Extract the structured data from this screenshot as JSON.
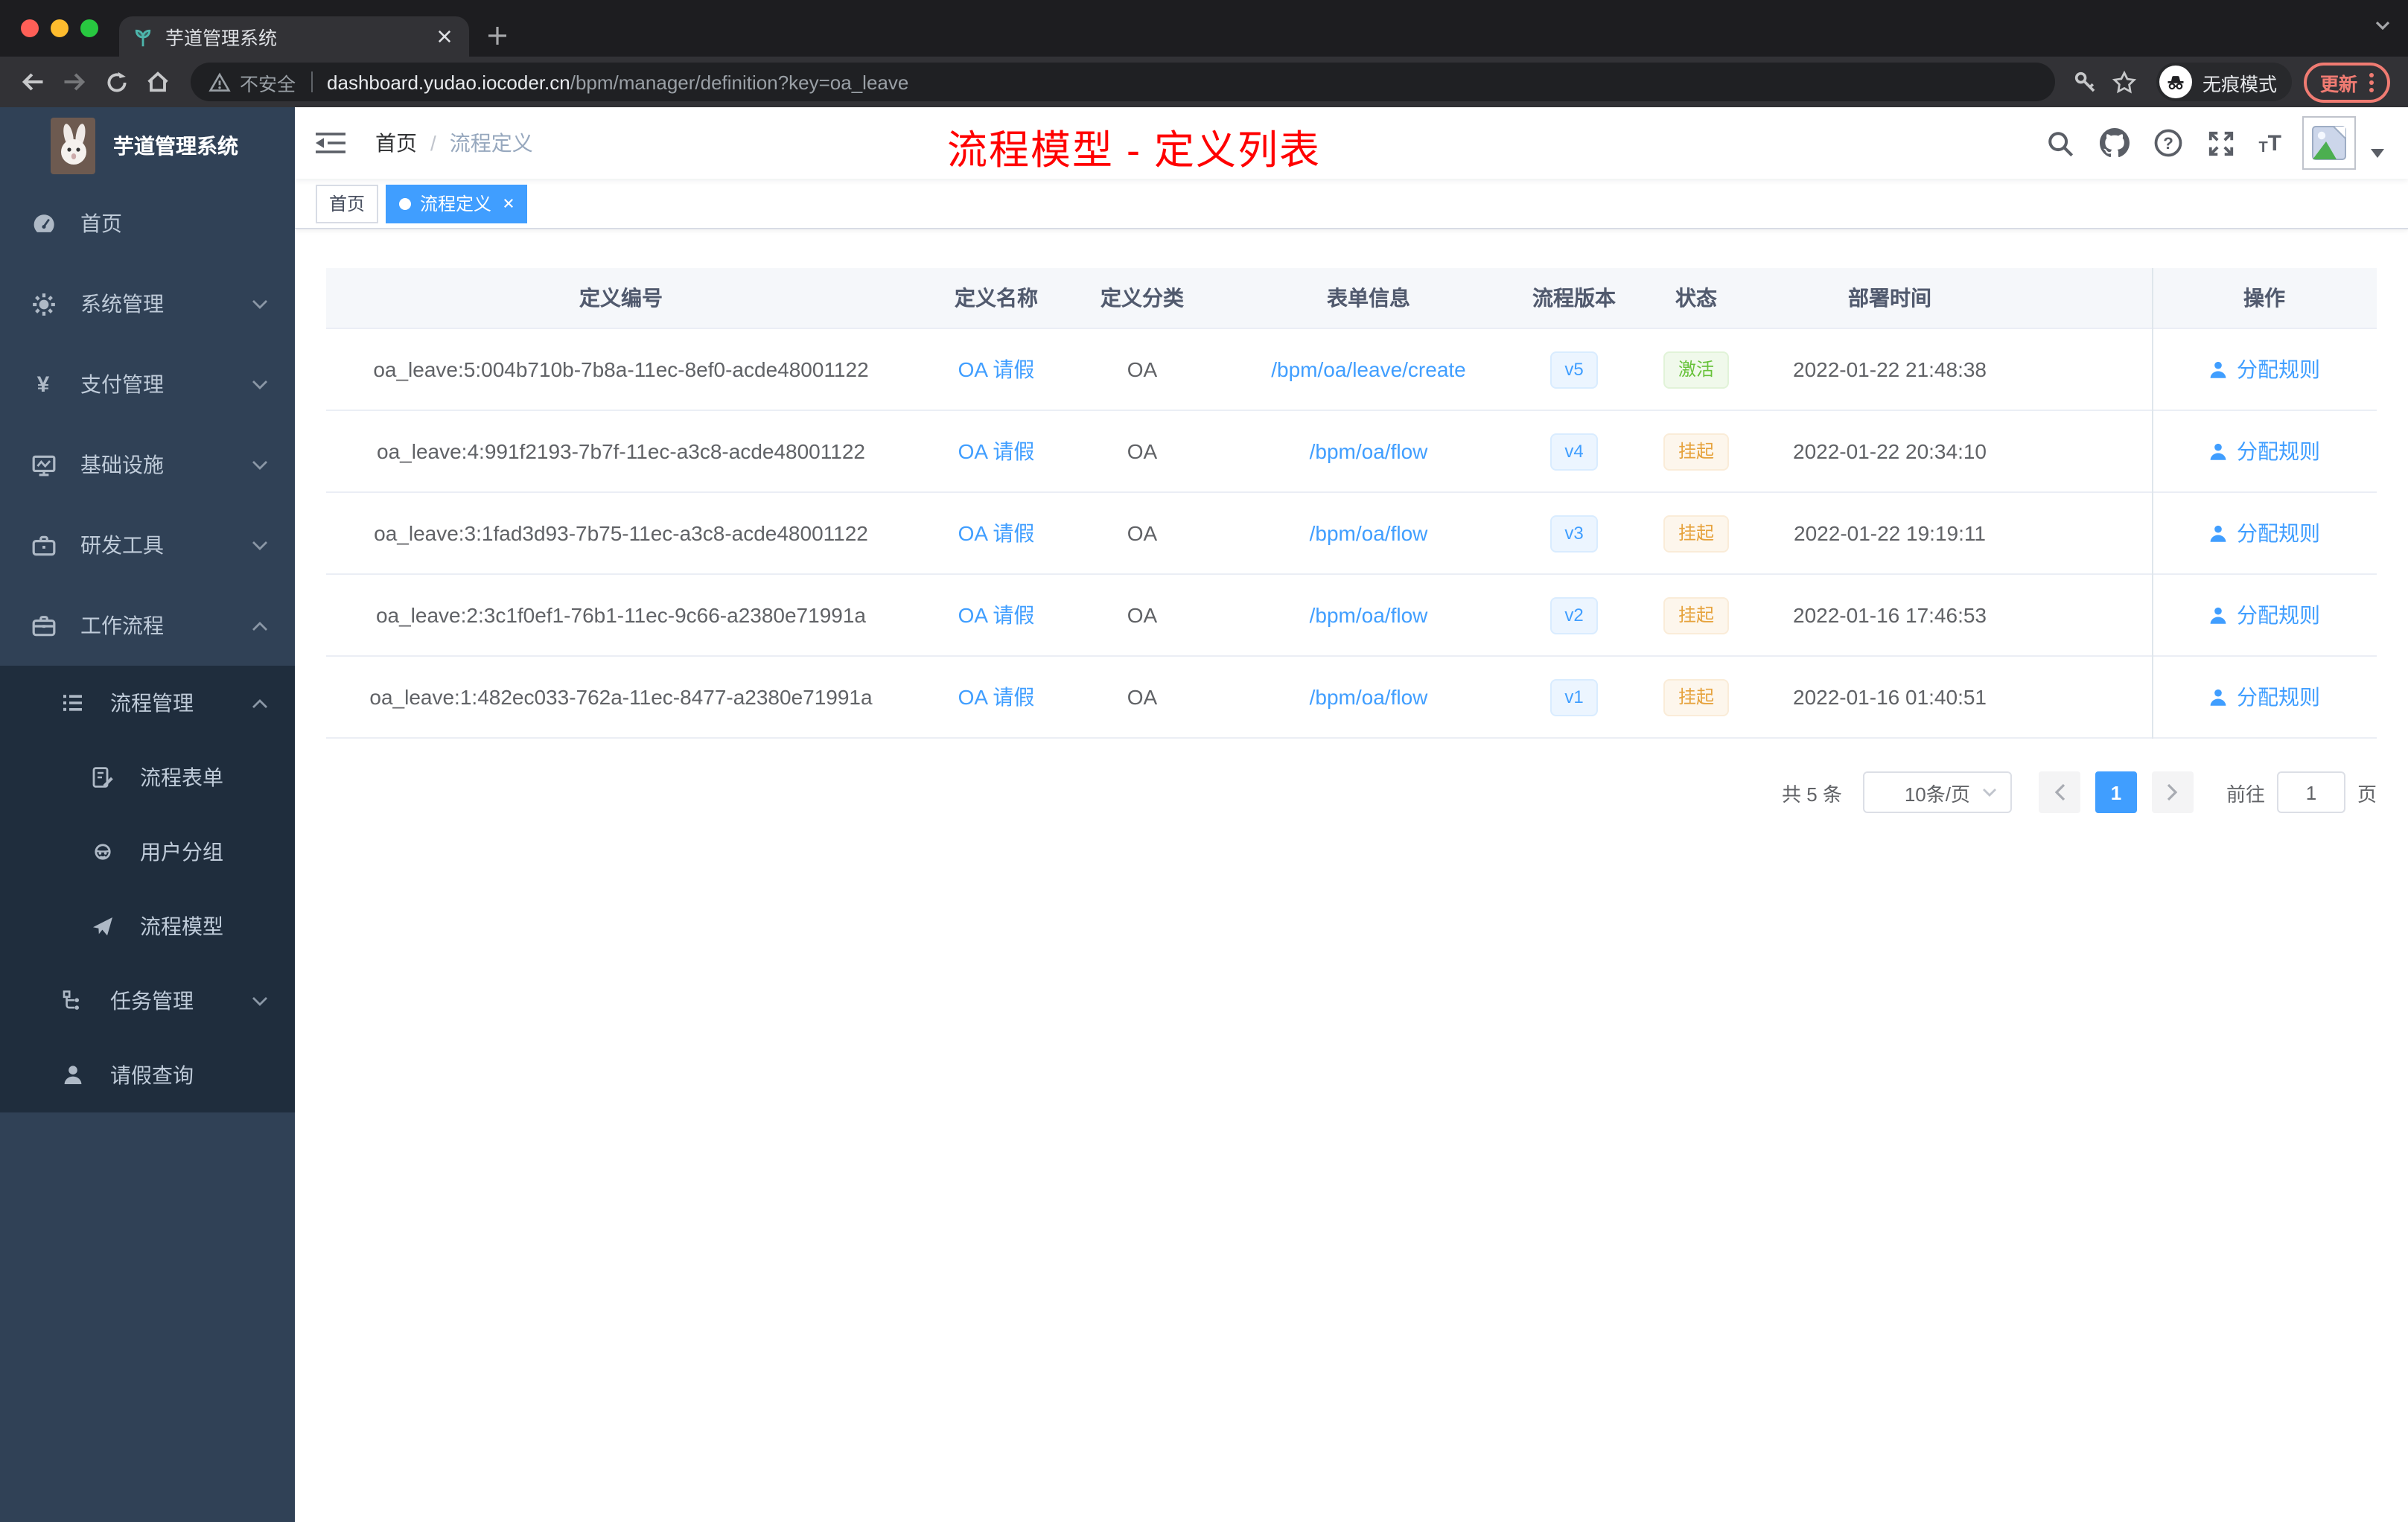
{
  "browser": {
    "tab_title": "芋道管理系统",
    "security_label": "不安全",
    "url_domain": "dashboard.yudao.iocoder.cn",
    "url_path": "/bpm/manager/definition?key=oa_leave",
    "incognito_label": "无痕模式",
    "update_label": "更新"
  },
  "sidebar": {
    "logo_title": "芋道管理系统",
    "items": [
      {
        "label": "首页"
      },
      {
        "label": "系统管理"
      },
      {
        "label": "支付管理",
        "icon_char": "¥"
      },
      {
        "label": "基础设施"
      },
      {
        "label": "研发工具"
      },
      {
        "label": "工作流程"
      }
    ],
    "workflow_submenu": [
      {
        "label": "流程管理"
      },
      {
        "label": "流程表单"
      },
      {
        "label": "用户分组"
      },
      {
        "label": "流程模型"
      },
      {
        "label": "任务管理"
      },
      {
        "label": "请假查询"
      }
    ]
  },
  "header": {
    "breadcrumb": {
      "home": "首页",
      "separator": "/",
      "current": "流程定义"
    },
    "annotation": "流程模型 - 定义列表"
  },
  "tags": [
    {
      "label": "首页"
    },
    {
      "label": "流程定义"
    }
  ],
  "table": {
    "columns": [
      "定义编号",
      "定义名称",
      "定义分类",
      "表单信息",
      "流程版本",
      "状态",
      "部署时间",
      "操作"
    ],
    "rows": [
      {
        "id": "oa_leave:5:004b710b-7b8a-11ec-8ef0-acde48001122",
        "name": "OA 请假",
        "category": "OA",
        "form": "/bpm/oa/leave/create",
        "version": "v5",
        "status": "激活",
        "status_type": "success",
        "deploy_time": "2022-01-22 21:48:38",
        "action": "分配规则"
      },
      {
        "id": "oa_leave:4:991f2193-7b7f-11ec-a3c8-acde48001122",
        "name": "OA 请假",
        "category": "OA",
        "form": "/bpm/oa/flow",
        "version": "v4",
        "status": "挂起",
        "status_type": "warning",
        "deploy_time": "2022-01-22 20:34:10",
        "action": "分配规则"
      },
      {
        "id": "oa_leave:3:1fad3d93-7b75-11ec-a3c8-acde48001122",
        "name": "OA 请假",
        "category": "OA",
        "form": "/bpm/oa/flow",
        "version": "v3",
        "status": "挂起",
        "status_type": "warning",
        "deploy_time": "2022-01-22 19:19:11",
        "action": "分配规则"
      },
      {
        "id": "oa_leave:2:3c1f0ef1-76b1-11ec-9c66-a2380e71991a",
        "name": "OA 请假",
        "category": "OA",
        "form": "/bpm/oa/flow",
        "version": "v2",
        "status": "挂起",
        "status_type": "warning",
        "deploy_time": "2022-01-16 17:46:53",
        "action": "分配规则"
      },
      {
        "id": "oa_leave:1:482ec033-762a-11ec-8477-a2380e71991a",
        "name": "OA 请假",
        "category": "OA",
        "form": "/bpm/oa/flow",
        "version": "v1",
        "status": "挂起",
        "status_type": "warning",
        "deploy_time": "2022-01-16 01:40:51",
        "action": "分配规则"
      }
    ]
  },
  "pagination": {
    "total_label": "共 5 条",
    "page_size_label": "10条/页",
    "current_page": "1",
    "goto_label": "前往",
    "goto_value": "1",
    "page_unit": "页"
  },
  "colors": {
    "accent": "#409eff",
    "success": "#67c23a",
    "warning": "#e6a23c",
    "annotation_red": "#ff0000",
    "sidebar_bg": "#304156",
    "submenu_bg": "#1f2d3d",
    "active_tag": "#409eff"
  }
}
